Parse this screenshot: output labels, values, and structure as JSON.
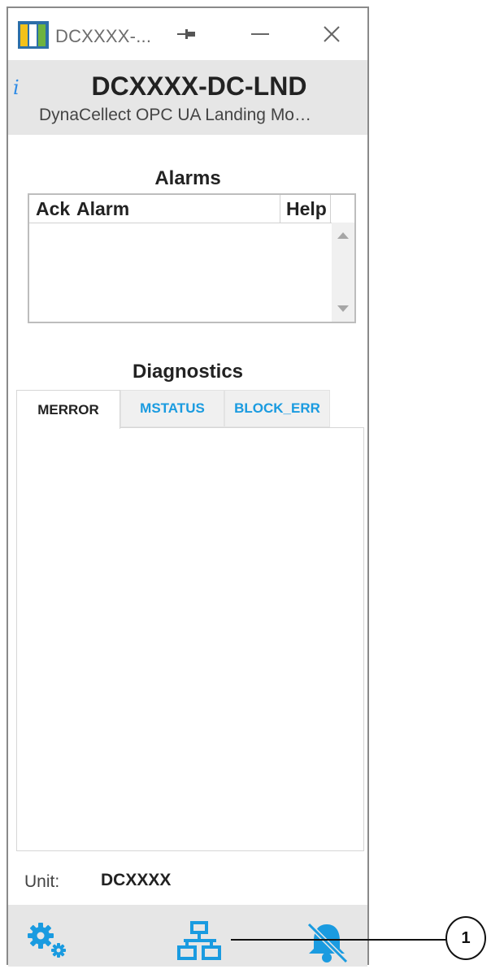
{
  "titlebar": {
    "title": "DCXXXX-...",
    "logo_icon": "app-logo-icon",
    "pin_icon": "pin-icon",
    "minimize_icon": "minimize-icon",
    "close_icon": "close-icon"
  },
  "header": {
    "info_glyph": "i",
    "device_name": "DCXXXX-DC-LND",
    "subtitle": "DynaCellect OPC UA Landing Mo…"
  },
  "alarms": {
    "title": "Alarms",
    "columns": [
      "Ack",
      "Alarm",
      "Help"
    ],
    "rows": []
  },
  "diagnostics": {
    "title": "Diagnostics",
    "tabs": [
      {
        "label": "MERROR",
        "active": true
      },
      {
        "label": "MSTATUS",
        "active": false
      },
      {
        "label": "BLOCK_ERR",
        "active": false
      }
    ]
  },
  "unit": {
    "label": "Unit:",
    "value": "DCXXXX"
  },
  "footer": {
    "buttons": [
      {
        "icon": "settings-gears-icon"
      },
      {
        "icon": "network-icon"
      },
      {
        "icon": "bell-muted-icon"
      }
    ]
  },
  "callout": {
    "number": "1"
  },
  "colors": {
    "accent": "#1a9be0",
    "header_bg": "#e6e6e6",
    "info": "#2e8be6"
  }
}
